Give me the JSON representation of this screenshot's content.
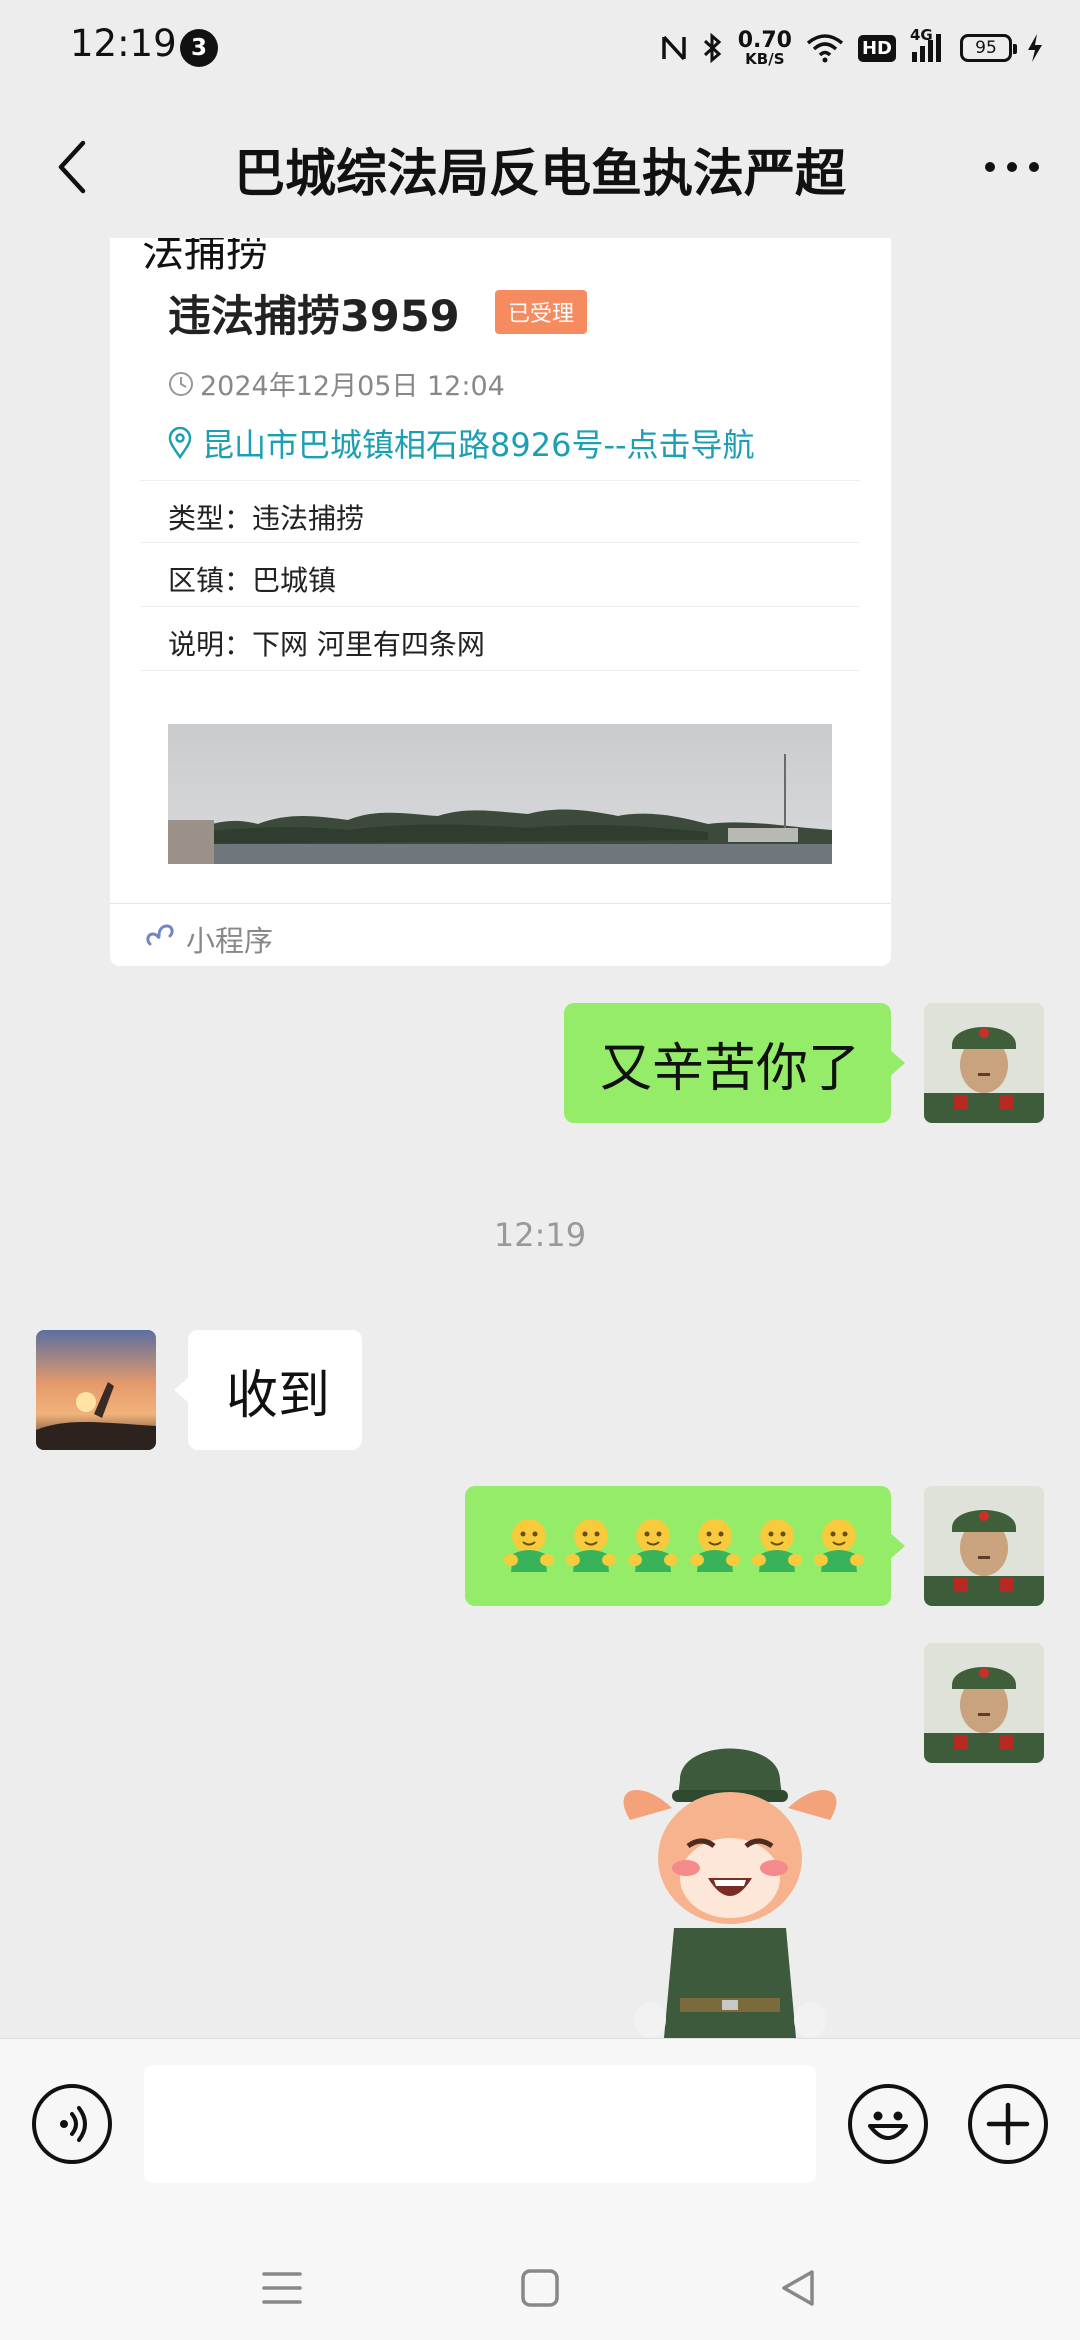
{
  "status_bar": {
    "time": "12:19",
    "notification_count": "3",
    "net_speed_value": "0.70",
    "net_speed_unit": "KB/S",
    "hd_label": "HD",
    "network_label": "4G",
    "battery_level": "95"
  },
  "header": {
    "title": "巴城综法局反电鱼执法严超",
    "back_icon": "chevron-left-icon",
    "more_icon": "more-dots-icon"
  },
  "card": {
    "partial_title": "法捕捞",
    "record_title": "违法捕捞3959",
    "status": "已受理",
    "time": "2024年12月05日 12:04",
    "address": "昆山市巴城镇相石路8926号--点击导航",
    "type_row": "类型：违法捕捞",
    "district_row": "区镇：巴城镇",
    "note_row": "说明：下网 河里有四条网",
    "footer_label": "小程序",
    "colors": {
      "status_chip": "#f58b5e",
      "address_link": "#1c9fb3"
    }
  },
  "messages": [
    {
      "side": "right",
      "kind": "text",
      "text": "又辛苦你了"
    },
    {
      "side": "center",
      "kind": "time",
      "text": "12:19"
    },
    {
      "side": "left",
      "kind": "text",
      "text": "收到"
    },
    {
      "side": "right",
      "kind": "emoji",
      "count": 6,
      "emoji_name": "hug-emoji"
    },
    {
      "side": "right",
      "kind": "sticker",
      "sticker_name": "cartoon-deer-soldier-sticker"
    }
  ],
  "input_bar": {
    "voice_icon": "voice-icon",
    "emoji_icon": "smiley-icon",
    "plus_icon": "plus-icon",
    "input_value": ""
  },
  "nav_bar": {
    "icons": [
      "menu-icon",
      "home-square-icon",
      "back-triangle-icon"
    ]
  },
  "colors": {
    "bubble_self": "#95ec69",
    "bubble_other": "#ffffff",
    "background": "#ededed"
  }
}
